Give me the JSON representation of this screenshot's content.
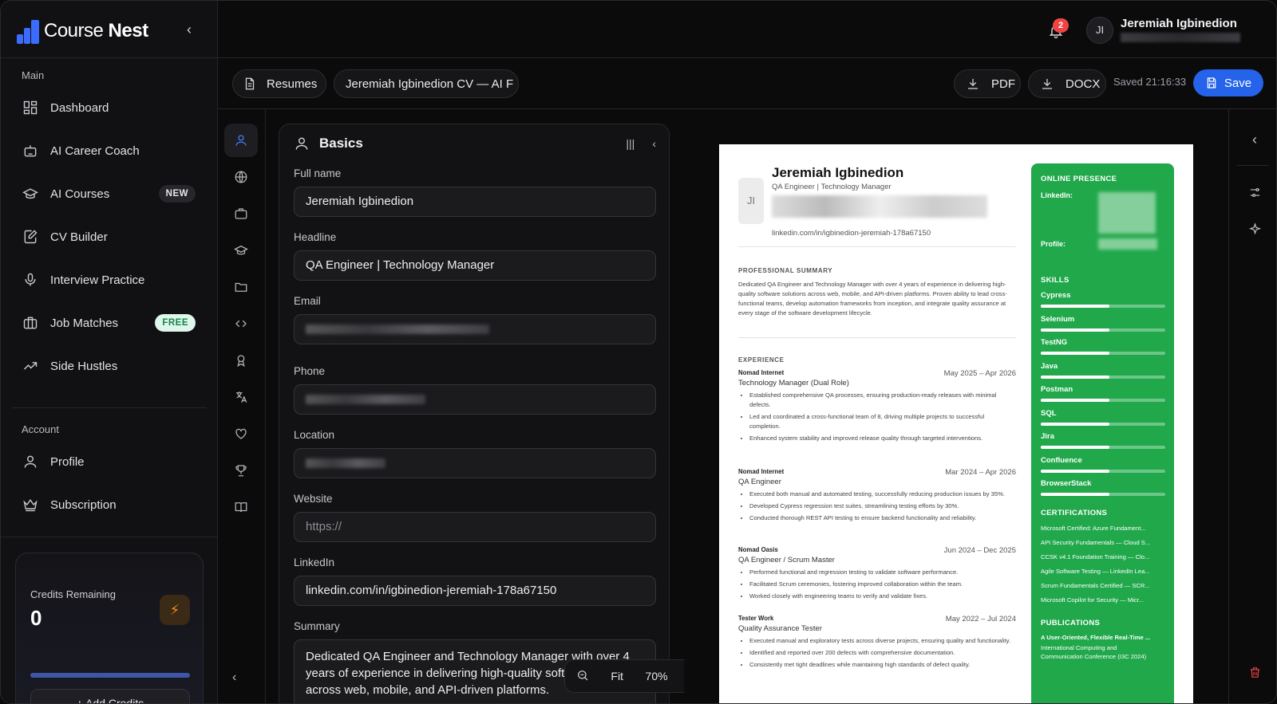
{
  "brand": {
    "name_part1": "Course",
    "name_part2": "Nest"
  },
  "sidebar": {
    "section_main": "Main",
    "items": [
      {
        "label": "Dashboard",
        "icon": "dashboard-icon"
      },
      {
        "label": "AI Career Coach",
        "icon": "robot-icon"
      },
      {
        "label": "AI Courses",
        "icon": "graduation-cap-icon",
        "badge": "NEW"
      },
      {
        "label": "CV Builder",
        "icon": "edit-document-icon"
      },
      {
        "label": "Interview Practice",
        "icon": "microphone-icon"
      },
      {
        "label": "Job Matches",
        "icon": "briefcase-icon",
        "badge": "FREE"
      },
      {
        "label": "Side Hustles",
        "icon": "trending-up-icon"
      }
    ],
    "section_account": "Account",
    "account_items": [
      {
        "label": "Profile",
        "icon": "user-icon"
      },
      {
        "label": "Subscription",
        "icon": "crown-icon"
      }
    ],
    "credits": {
      "title": "Credits Remaining",
      "value": "0",
      "button": "+ Add Credits"
    }
  },
  "topbar": {
    "notification_count": "2",
    "avatar_initials": "JI",
    "user_name": "Jeremiah Igbinedion"
  },
  "toolbar": {
    "resumes_label": "Resumes",
    "doc_title": "Jeremiah Igbinedion CV — AI F",
    "pdf_label": "PDF",
    "docx_label": "DOCX",
    "saved_text": "Saved 21:16:33",
    "save_label": "Save"
  },
  "editor": {
    "section_title": "Basics",
    "fields": {
      "full_name_label": "Full name",
      "full_name_value": "Jeremiah Igbinedion",
      "headline_label": "Headline",
      "headline_value": "QA Engineer | Technology Manager",
      "email_label": "Email",
      "phone_label": "Phone",
      "location_label": "Location",
      "website_label": "Website",
      "website_placeholder": "https://",
      "linkedin_label": "LinkedIn",
      "linkedin_value": "linkedin.com/in/igbinedion-jeremiah-178a67150",
      "summary_label": "Summary",
      "summary_value": "Dedicated QA Engineer and Technology Manager with over 4 years of experience in delivering high-quality software solutions across web, mobile, and API-driven platforms."
    },
    "zoom": {
      "fit_label": "Fit",
      "level": "70%"
    }
  },
  "resume": {
    "avatar_initials": "JI",
    "name": "Jeremiah Igbinedion",
    "headline": "QA Engineer | Technology Manager",
    "linkedin": "linkedin.com/in/igbinedion-jeremiah-178a67150",
    "summary_heading": "PROFESSIONAL SUMMARY",
    "summary": "Dedicated QA Engineer and Technology Manager with over 4 years of experience in delivering high-quality software solutions across web, mobile, and API-driven platforms. Proven ability to lead cross-functional teams, develop automation frameworks from inception, and integrate quality assurance at every stage of the software development lifecycle.",
    "experience_heading": "EXPERIENCE",
    "jobs": [
      {
        "company": "Nomad Internet",
        "dates": "May 2025 – Apr 2026",
        "title": "Technology Manager (Dual Role)",
        "bullets": [
          "Established comprehensive QA processes, ensuring production-ready releases with minimal defects.",
          "Led and coordinated a cross-functional team of 8, driving multiple projects to successful completion.",
          "Enhanced system stability and improved release quality through targeted interventions."
        ]
      },
      {
        "company": "Nomad Internet",
        "dates": "Mar 2024 – Apr 2026",
        "title": "QA Engineer",
        "bullets": [
          "Executed both manual and automated testing, successfully reducing production issues by 35%.",
          "Developed Cypress regression test suites, streamlining testing efforts by 30%.",
          "Conducted thorough REST API testing to ensure backend functionality and reliability."
        ]
      },
      {
        "company": "Nomad Oasis",
        "dates": "Jun 2024 – Dec 2025",
        "title": "QA Engineer / Scrum Master",
        "bullets": [
          "Performed functional and regression testing to validate software performance.",
          "Facilitated Scrum ceremonies, fostering improved collaboration within the team.",
          "Worked closely with engineering teams to verify and validate fixes."
        ]
      },
      {
        "company": "Tester Work",
        "dates": "May 2022 – Jul 2024",
        "title": "Quality Assurance Tester",
        "bullets": [
          "Executed manual and exploratory tests across diverse projects, ensuring quality and functionality.",
          "Identified and reported over 200 defects with comprehensive documentation.",
          "Consistently met tight deadlines while maintaining high standards of defect quality."
        ]
      }
    ],
    "sidebar": {
      "online_heading": "ONLINE PRESENCE",
      "linkedin_label": "LinkedIn:",
      "profile_label": "Profile:",
      "skills_heading": "SKILLS",
      "skills": [
        {
          "name": "Cypress",
          "level": 0.55
        },
        {
          "name": "Selenium",
          "level": 0.55
        },
        {
          "name": "TestNG",
          "level": 0.55
        },
        {
          "name": "Java",
          "level": 0.55
        },
        {
          "name": "Postman",
          "level": 0.55
        },
        {
          "name": "SQL",
          "level": 0.55
        },
        {
          "name": "Jira",
          "level": 0.55
        },
        {
          "name": "Confluence",
          "level": 0.55
        },
        {
          "name": "BrowserStack",
          "level": 0.55
        }
      ],
      "certifications_heading": "CERTIFICATIONS",
      "certifications": [
        "Microsoft Certified: Azure Fundament...",
        "API Security Fundamentals — Cloud S...",
        "CCSK v4.1 Foundation Training — Clo...",
        "Agile Software Testing — LinkedIn Lea...",
        "Scrum Fundamentals Certified — SCR...",
        "Microsoft Copilot for Security — Micr..."
      ],
      "publications_heading": "PUBLICATIONS",
      "publication_title": "A User-Oriented, Flexible Real-Time ...",
      "publication_source": "International Computing and Communication Conference (I3C 2024)"
    }
  },
  "colors": {
    "accent": "#2563eb",
    "resume_sidebar": "#20a84a",
    "badge_free": "#12864a"
  }
}
